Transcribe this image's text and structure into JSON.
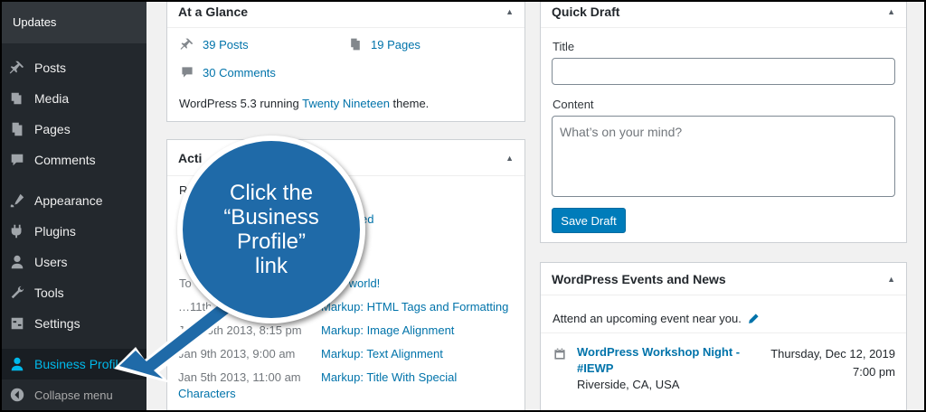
{
  "sidebar": {
    "updates_label": "Updates",
    "items": [
      {
        "label": "Posts",
        "icon": "pin-icon"
      },
      {
        "label": "Media",
        "icon": "media-icon"
      },
      {
        "label": "Pages",
        "icon": "pages-icon"
      },
      {
        "label": "Comments",
        "icon": "comments-icon"
      },
      {
        "label": "Appearance",
        "icon": "appearance-icon"
      },
      {
        "label": "Plugins",
        "icon": "plugins-icon"
      },
      {
        "label": "Users",
        "icon": "users-icon"
      },
      {
        "label": "Tools",
        "icon": "tools-icon"
      },
      {
        "label": "Settings",
        "icon": "settings-icon"
      },
      {
        "label": "Business Profile",
        "icon": "business-profile-icon"
      },
      {
        "label": "Collapse menu",
        "icon": "collapse-icon"
      }
    ]
  },
  "glance": {
    "title": "At a Glance",
    "posts": "39 Posts",
    "pages": "19 Pages",
    "comments": "30 Comments",
    "running_prefix": "WordPress 5.3 running ",
    "theme": "Twenty Nineteen",
    "running_suffix": " theme."
  },
  "activity": {
    "title_visible": "Acti",
    "partial_label_1": "R",
    "partial_text_1": "ed",
    "partial_label_2": "R",
    "partial_label_3": "To",
    "partial_hello": "llo world!",
    "rows": [
      {
        "date": "…11th 2013, 5:55 pm",
        "title": "Markup: HTML Tags and Formatting"
      },
      {
        "date": "Jan 10th 2013, 8:15 pm",
        "title": "Markup: Image Alignment"
      },
      {
        "date": "Jan 9th 2013, 9:00 am",
        "title": "Markup: Text Alignment"
      },
      {
        "date": "Jan 5th 2013, 11:00 am",
        "title": "Markup: Title With Special"
      }
    ],
    "wrap_text": "Characters"
  },
  "quick_draft": {
    "title": "Quick Draft",
    "title_label": "Title",
    "title_value": "",
    "content_label": "Content",
    "content_placeholder": "What’s on your mind?",
    "save_label": "Save Draft"
  },
  "events": {
    "title": "WordPress Events and News",
    "intro": "Attend an upcoming event near you.",
    "event_title_1": "WordPress Workshop Night -",
    "event_title_2": "#IEWP",
    "event_location": "Riverside, CA, USA",
    "event_date": "Thursday, Dec 12, 2019",
    "event_time": "7:00 pm"
  },
  "callout": {
    "text": "Click the\n“Business\nProfile”\nlink"
  }
}
